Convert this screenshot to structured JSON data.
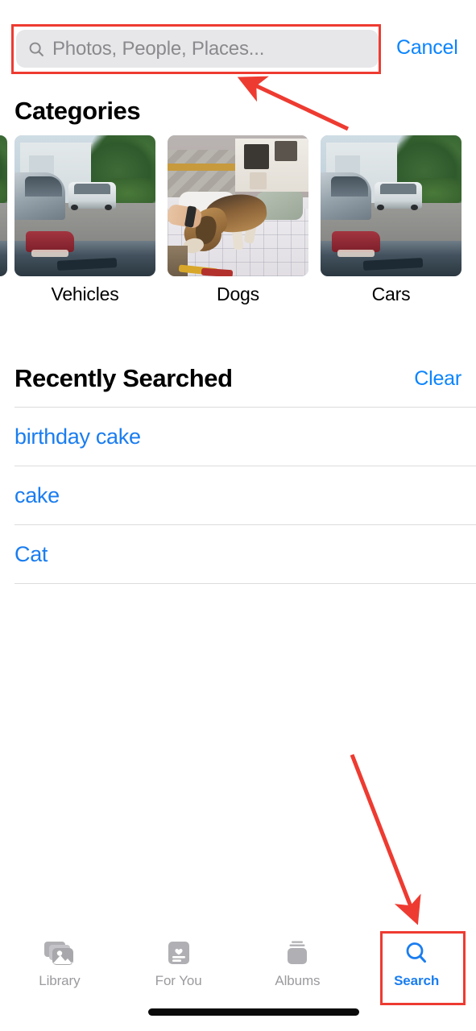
{
  "app": "Photos",
  "screen": "Search",
  "search": {
    "placeholder": "Photos, People, Places...",
    "value": "",
    "icon": "search-icon",
    "cancel_label": "Cancel"
  },
  "categories": {
    "title": "Categories",
    "items": [
      {
        "label": "",
        "scene": "car",
        "partial": true
      },
      {
        "label": "Vehicles",
        "scene": "car",
        "partial": false
      },
      {
        "label": "Dogs",
        "scene": "dog",
        "partial": false
      },
      {
        "label": "Cars",
        "scene": "car",
        "partial": false
      }
    ]
  },
  "recently_searched": {
    "title": "Recently Searched",
    "clear_label": "Clear",
    "items": [
      {
        "text": "birthday cake"
      },
      {
        "text": "cake"
      },
      {
        "text": "Cat"
      }
    ]
  },
  "tabbar": {
    "tabs": [
      {
        "label": "Library",
        "icon": "photo-stack-icon",
        "active": false
      },
      {
        "label": "For You",
        "icon": "heart-card-icon",
        "active": false
      },
      {
        "label": "Albums",
        "icon": "albums-stack-icon",
        "active": false
      },
      {
        "label": "Search",
        "icon": "search-icon",
        "active": true
      }
    ]
  },
  "colors": {
    "accent_blue": "#0a84ff",
    "link_blue": "#1a7df0",
    "annotation_red": "#ee3b31",
    "field_gray": "#e7e7e9",
    "inactive_gray": "#9b9b9f"
  }
}
